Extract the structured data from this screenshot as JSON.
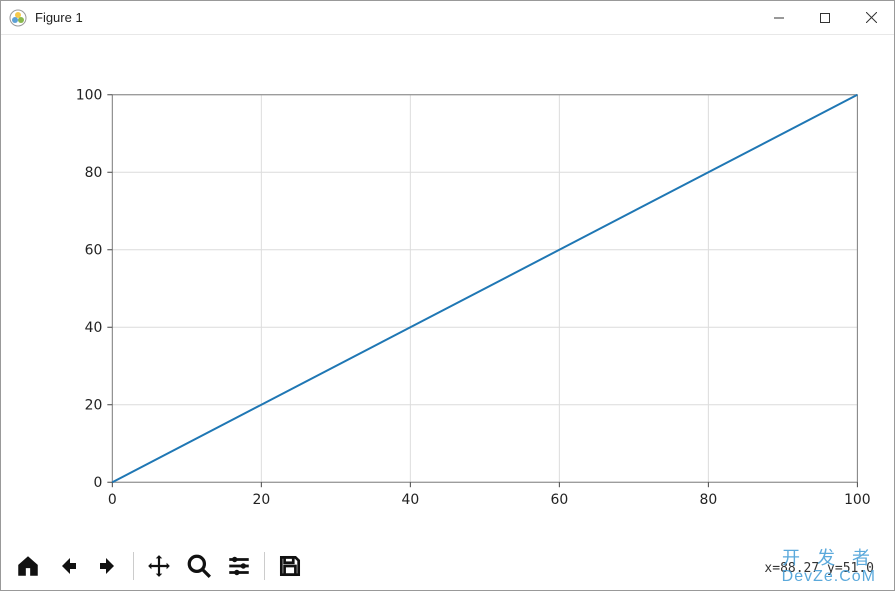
{
  "window": {
    "title": "Figure 1",
    "minimize_label": "Minimize",
    "maximize_label": "Maximize",
    "close_label": "Close"
  },
  "chart_data": {
    "type": "line",
    "x": [
      0,
      20,
      40,
      60,
      80,
      100
    ],
    "y": [
      0,
      20,
      40,
      60,
      80,
      100
    ],
    "title": "",
    "xlabel": "",
    "ylabel": "",
    "xlim": [
      0,
      100
    ],
    "ylim": [
      0,
      100
    ],
    "xticks": [
      0,
      20,
      40,
      60,
      80,
      100
    ],
    "yticks": [
      0,
      20,
      40,
      60,
      80,
      100
    ],
    "grid": true,
    "line_color": "#1f77b4"
  },
  "toolbar": {
    "home": "Home",
    "back": "Back",
    "forward": "Forward",
    "pan": "Pan",
    "zoom": "Zoom",
    "configure": "Configure subplots",
    "save": "Save"
  },
  "status": {
    "coord_text": "x=88.27 y=51.0"
  },
  "watermark": {
    "line1": "开 发 者",
    "line2": "DevZe.CoM"
  }
}
